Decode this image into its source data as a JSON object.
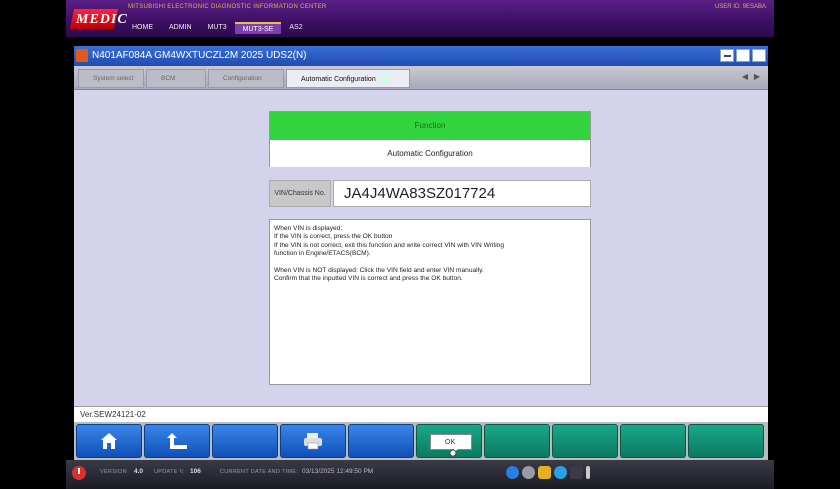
{
  "header": {
    "logo_text": "MEDIC",
    "subtitle": "MITSUBISHI ELECTRONIC DIAGNOSTIC INFORMATION CENTER",
    "nav": [
      "HOME",
      "ADMIN",
      "MUT3",
      "MUT3-SE",
      "AS2"
    ],
    "active_nav": "MUT3-SE",
    "user_id": "USER ID:   9ESABA"
  },
  "window": {
    "title": "N401AF084A  GM4WXTUCZL2M 2025  UDS2(N)"
  },
  "tabs": [
    {
      "label": "System select",
      "active": false
    },
    {
      "label": "BCM",
      "active": false
    },
    {
      "label": "Configuration",
      "active": false
    },
    {
      "label": "Automatic Configuration",
      "active": true
    }
  ],
  "function": {
    "header": "Function",
    "name": "Automatic Configuration"
  },
  "vin": {
    "label": "VIN/Chassis No.",
    "value": "JA4J4WA83SZ017724"
  },
  "instructions": [
    "When VIN is displayed:",
    "If the VIN is correct, press the OK button",
    "If the VIN is not correct, exit this function and write correct VIN with VIN Writing",
    "function in Engine/ETACS(BCM).",
    "",
    "When VIN is NOT displayed: Click the VIN field and enter VIN manually.",
    "Confirm that the inputted VIN is correct and press the OK button."
  ],
  "version": "Ver.SEW24121-02",
  "toolbar": {
    "ok_label": "OK"
  },
  "taskbar": {
    "version_label": "VERSION",
    "version_value": "4.0",
    "update_label": "UPDATE V.",
    "update_value": "106",
    "datetime_label": "CURRENT DATE AND TIME:",
    "datetime_value": "03/13/2025 12:49:50 PM"
  },
  "colors": {
    "header_bg": "#3c0f63",
    "title_bar": "#1f4cb0",
    "content_bg": "#d3d3ec",
    "function_header": "#32d43e",
    "toolbar_blue": "#1d63cc",
    "toolbar_green": "#0b7a60"
  }
}
